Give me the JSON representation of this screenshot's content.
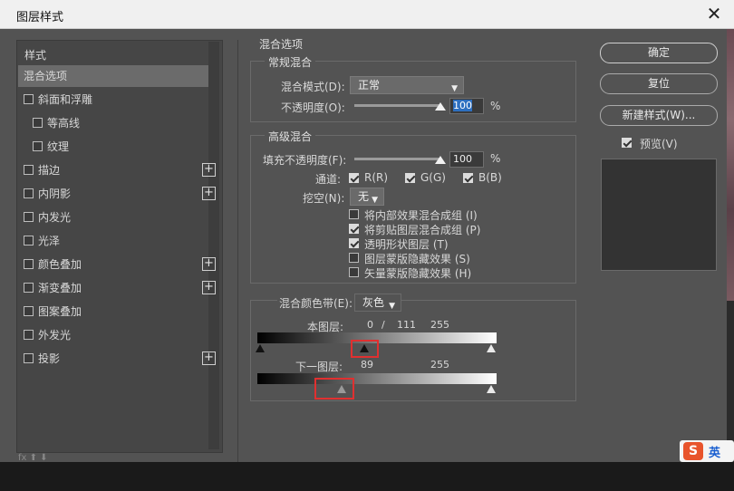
{
  "window": {
    "title": "图层样式",
    "close_glyph": "✕"
  },
  "sidebar": {
    "header": "样式",
    "items": [
      {
        "label": "混合选项",
        "checkbox": false,
        "checked": false,
        "plus": false,
        "selected": true
      },
      {
        "label": "斜面和浮雕",
        "checkbox": true,
        "checked": false,
        "plus": false
      },
      {
        "label": "等高线",
        "checkbox": true,
        "checked": false,
        "plus": false,
        "indent": true
      },
      {
        "label": "纹理",
        "checkbox": true,
        "checked": false,
        "plus": false,
        "indent": true
      },
      {
        "label": "描边",
        "checkbox": true,
        "checked": false,
        "plus": true
      },
      {
        "label": "内阴影",
        "checkbox": true,
        "checked": false,
        "plus": true
      },
      {
        "label": "内发光",
        "checkbox": true,
        "checked": false,
        "plus": false
      },
      {
        "label": "光泽",
        "checkbox": true,
        "checked": false,
        "plus": false
      },
      {
        "label": "颜色叠加",
        "checkbox": true,
        "checked": false,
        "plus": true
      },
      {
        "label": "渐变叠加",
        "checkbox": true,
        "checked": false,
        "plus": true
      },
      {
        "label": "图案叠加",
        "checkbox": true,
        "checked": false,
        "plus": false
      },
      {
        "label": "外发光",
        "checkbox": true,
        "checked": false,
        "plus": false
      },
      {
        "label": "投影",
        "checkbox": true,
        "checked": false,
        "plus": true
      }
    ],
    "plus_glyph": "+",
    "bottom_icons": "fx  ⬆  ⬇"
  },
  "blend_options": {
    "title": "混合选项",
    "general": {
      "title": "常规混合",
      "mode_label": "混合模式(D):",
      "mode_value": "正常",
      "opacity_label": "不透明度(O):",
      "opacity_value": "100",
      "opacity_unit": "%",
      "opacity_level": 1.0
    },
    "advanced": {
      "title": "高级混合",
      "fill_label": "填充不透明度(F):",
      "fill_value": "100",
      "fill_unit": "%",
      "fill_level": 1.0,
      "channels_label": "通道:",
      "channels": [
        {
          "label": "R(R)",
          "checked": true
        },
        {
          "label": "G(G)",
          "checked": true
        },
        {
          "label": "B(B)",
          "checked": true
        }
      ],
      "knockout_label": "挖空(N):",
      "knockout_value": "无",
      "options": [
        {
          "label": "将内部效果混合成组 (I)",
          "checked": false
        },
        {
          "label": "将剪贴图层混合成组 (P)",
          "checked": true
        },
        {
          "label": "透明形状图层 (T)",
          "checked": true
        },
        {
          "label": "图层蒙版隐藏效果 (S)",
          "checked": false
        },
        {
          "label": "矢量蒙版隐藏效果 (H)",
          "checked": false
        }
      ]
    },
    "blend_if": {
      "label": "混合颜色带(E):",
      "value": "灰色",
      "this_layer_label": "本图层:",
      "this_layer_values": [
        "0",
        "/",
        "111",
        "255"
      ],
      "underlying_label": "下一图层:",
      "underlying_values": [
        "89",
        "255"
      ]
    }
  },
  "buttons": {
    "ok": "确定",
    "reset": "复位",
    "new_style": "新建样式(W)...",
    "preview_label": "预览(V)",
    "preview_checked": true
  },
  "ime": {
    "logo": "S",
    "lang": "英"
  },
  "colors": {
    "dialog_bg": "#535353",
    "selection": "#6b6b6b",
    "highlight_red": "#e03030",
    "accent_blue": "#2d6fc0"
  }
}
